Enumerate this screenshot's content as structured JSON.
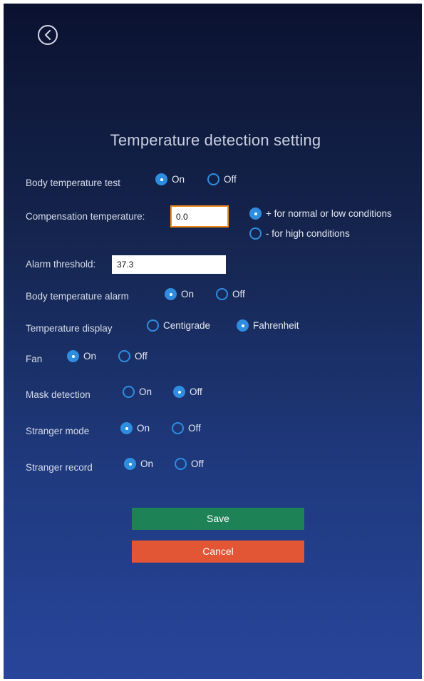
{
  "header": {
    "title": "Temperature detection setting"
  },
  "settings": {
    "body_temperature_test": {
      "label": "Body temperature test",
      "on": "On",
      "off": "Off"
    },
    "compensation": {
      "label": "Compensation temperature:",
      "value": "0.0",
      "option_plus": "+ for normal or low conditions",
      "option_minus": "- for high conditions"
    },
    "alarm_threshold": {
      "label": "Alarm threshold:",
      "value": "37.3"
    },
    "body_temperature_alarm": {
      "label": "Body temperature alarm",
      "on": "On",
      "off": "Off"
    },
    "temperature_display": {
      "label": "Temperature display",
      "centigrade": "Centigrade",
      "fahrenheit": "Fahrenheit"
    },
    "fan": {
      "label": "Fan",
      "on": "On",
      "off": "Off"
    },
    "mask_detection": {
      "label": "Mask detection",
      "on": "On",
      "off": "Off"
    },
    "stranger_mode": {
      "label": "Stranger mode",
      "on": "On",
      "off": "Off"
    },
    "stranger_record": {
      "label": "Stranger record",
      "on": "On",
      "off": "Off"
    }
  },
  "buttons": {
    "save": "Save",
    "cancel": "Cancel"
  },
  "icons": {
    "back": "back-arrow-circle-icon",
    "radio": "radio-button-icon"
  },
  "colors": {
    "accent": "#2f8de0",
    "save": "#1e8257",
    "cancel": "#e25535",
    "focus_border": "#f08c1a"
  }
}
